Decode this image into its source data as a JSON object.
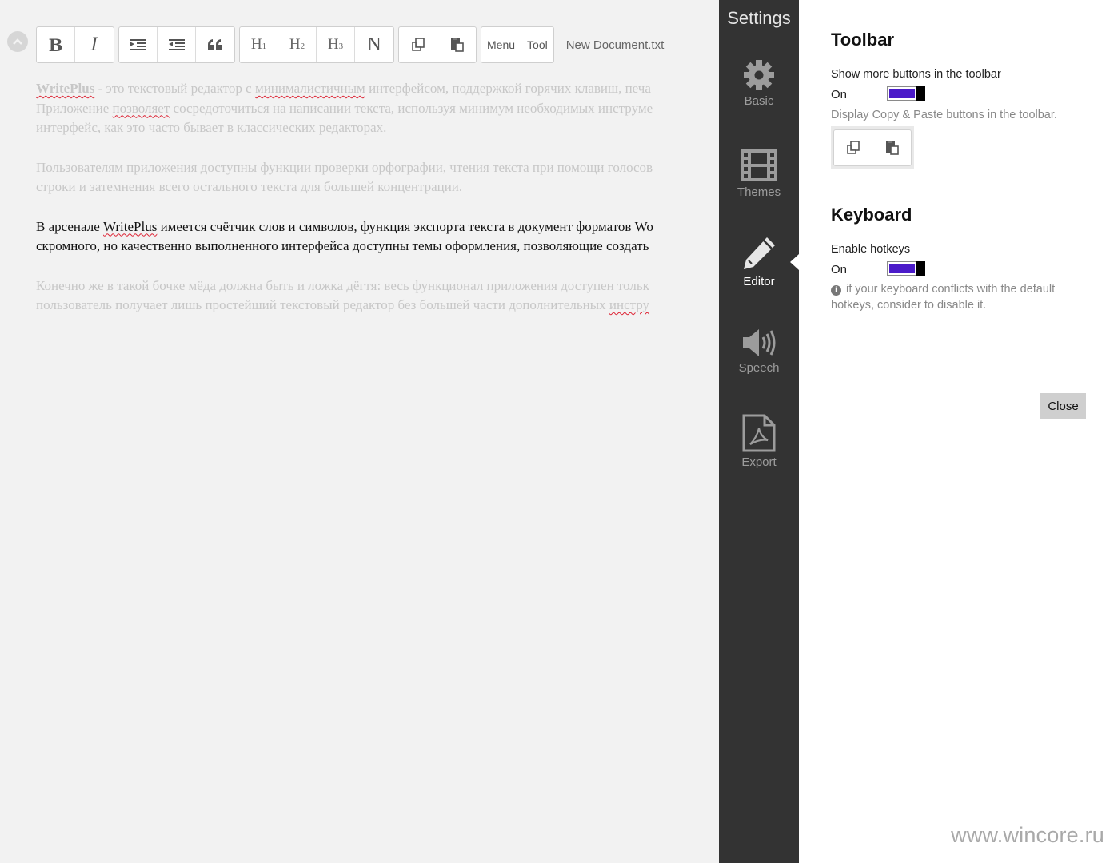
{
  "editor": {
    "toolbar": {
      "bold": "B",
      "italic": "I",
      "h1": "H",
      "h1_sub": "1",
      "h2": "H",
      "h2_sub": "2",
      "h3": "H",
      "h3_sub": "3",
      "normal": "N",
      "menu": "Menu",
      "tool": "Tool"
    },
    "document_name": "New Document.txt",
    "paragraphs": {
      "p1_l1_a": "WritePlus",
      "p1_l1_b": " - это текстовый редактор с ",
      "p1_l1_c": "минималистичным",
      "p1_l1_d": " интерфейсом, поддержкой горячих клавиш, печа",
      "p1_l2_a": "Приложение ",
      "p1_l2_b": "позволяет",
      "p1_l2_c": " сосредоточиться на написании текста, используя минимум необходимых инструме",
      "p1_l3": "интерфейс, как это часто бывает в классических редакторах.",
      "p2_l1": "Пользователям приложения доступны функции проверки орфографии, чтения текста при помощи голосов",
      "p2_l2": "строки и затемнения всего остального текста для большей концентрации.",
      "p3_l1_a": "В арсенале ",
      "p3_l1_b": "WritePlus",
      "p3_l1_c": " имеется счётчик слов и символов, функция экспорта текста в документ форматов Wo",
      "p3_l2": "скромного, но качественно выполненного интерфейса доступны темы оформления, позволяющие создать",
      "p4_l1": "Конечно же в такой бочке мёда должна быть и ложка дёгтя: весь функционал приложения доступен тольк",
      "p4_l2_a": "пользователь получает лишь простейший текстовый редактор без большей части дополнительных ",
      "p4_l2_b": "инстру"
    }
  },
  "settings_nav": {
    "title": "Settings",
    "items": [
      {
        "label": "Basic",
        "icon": "gear-icon"
      },
      {
        "label": "Themes",
        "icon": "film-icon"
      },
      {
        "label": "Editor",
        "icon": "pencil-icon",
        "active": true
      },
      {
        "label": "Speech",
        "icon": "speaker-icon"
      },
      {
        "label": "Export",
        "icon": "pdf-icon"
      }
    ]
  },
  "settings_panel": {
    "toolbar_section": {
      "title": "Toolbar",
      "option_label": "Show more buttons in the toolbar",
      "state": "On",
      "enabled": true,
      "description": "Display Copy & Paste buttons in the toolbar."
    },
    "keyboard_section": {
      "title": "Keyboard",
      "option_label": "Enable hotkeys",
      "state": "On",
      "enabled": true,
      "hint_icon": "i",
      "hint": " if your keyboard conflicts with the default hotkeys, consider to disable it."
    },
    "close_label": "Close"
  },
  "colors": {
    "toggle_fill": "#4b1bc9",
    "nav_background": "#333333",
    "editor_background": "#f2f2f2"
  },
  "watermark": "www.wincore.ru"
}
